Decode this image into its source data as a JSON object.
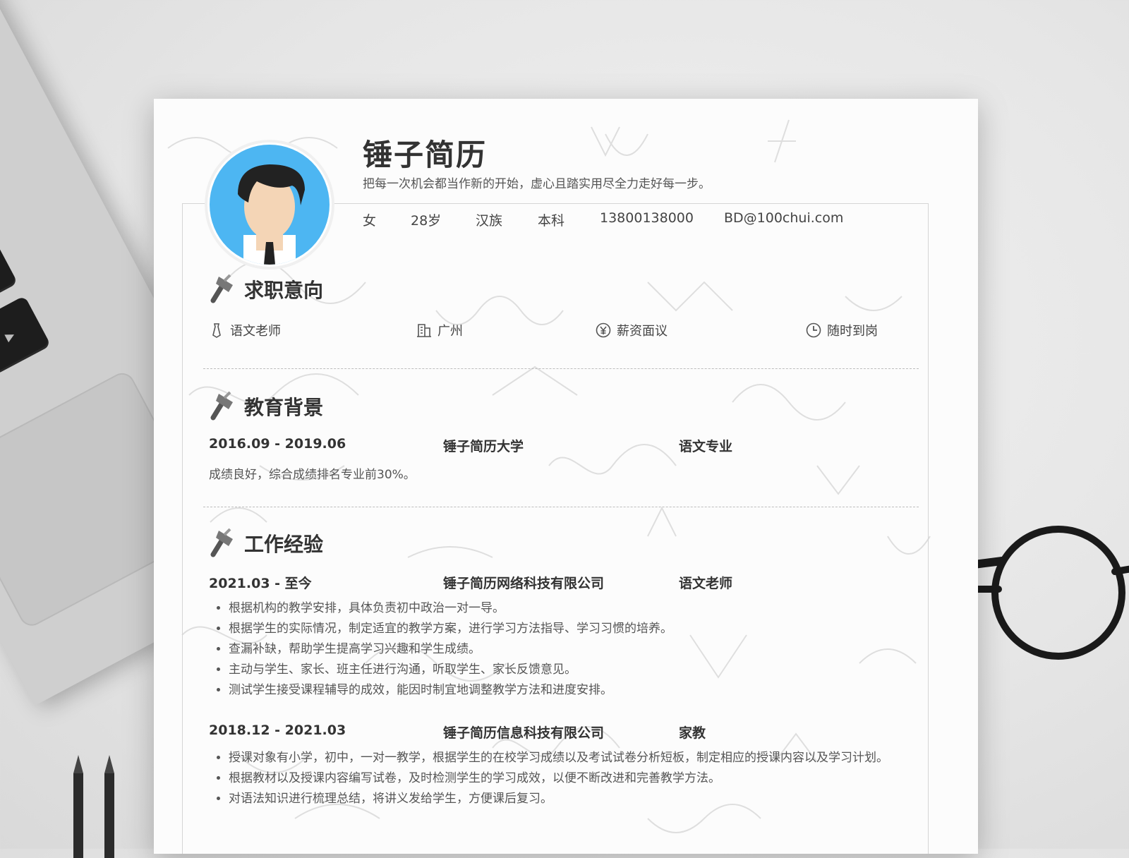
{
  "header": {
    "name": "锤子简历",
    "slogan": "把每一次机会都当作新的开始，虚心且踏实用尽全力走好每一步。",
    "info": [
      "女",
      "28岁",
      "汉族",
      "本科",
      "13800138000",
      "BD@100chui.com"
    ]
  },
  "intent": {
    "title": "求职意向",
    "items": [
      {
        "icon": "tie-icon",
        "label": "语文老师"
      },
      {
        "icon": "building-icon",
        "label": "广州"
      },
      {
        "icon": "yen-icon",
        "label": "薪资面议"
      },
      {
        "icon": "clock-icon",
        "label": "随时到岗"
      }
    ]
  },
  "education": {
    "title": "教育背景",
    "period": "2016.09 - 2019.06",
    "school": "锤子简历大学",
    "major": "语文专业",
    "desc": "成绩良好，综合成绩排名专业前30%。"
  },
  "work": {
    "title": "工作经验",
    "jobs": [
      {
        "period": "2021.03 - 至今",
        "company": "锤子简历网络科技有限公司",
        "role": "语文老师",
        "bullets": [
          "根据机构的教学安排，具体负责初中政治一对一导。",
          "根据学生的实际情况，制定适宜的教学方案，进行学习方法指导、学习习惯的培养。",
          "查漏补缺，帮助学生提高学习兴趣和学生成绩。",
          "主动与学生、家长、班主任进行沟通，听取学生、家长反馈意见。",
          "测试学生接受课程辅导的成效，能因时制宜地调整教学方法和进度安排。"
        ]
      },
      {
        "period": "2018.12 - 2021.03",
        "company": "锤子简历信息科技有限公司",
        "role": "家教",
        "bullets": [
          "授课对象有小学，初中，一对一教学，根据学生的在校学习成绩以及考试试卷分析短板，制定相应的授课内容以及学习计划。",
          "根据教材以及授课内容编写试卷，及时检测学生的学习成效，以便不断改进和完善教学方法。",
          "对语法知识进行梳理总结，将讲义发给学生，方便课后复习。"
        ]
      }
    ]
  },
  "colors": {
    "avatar_blue": "#4db6f2",
    "text": "#333333"
  }
}
